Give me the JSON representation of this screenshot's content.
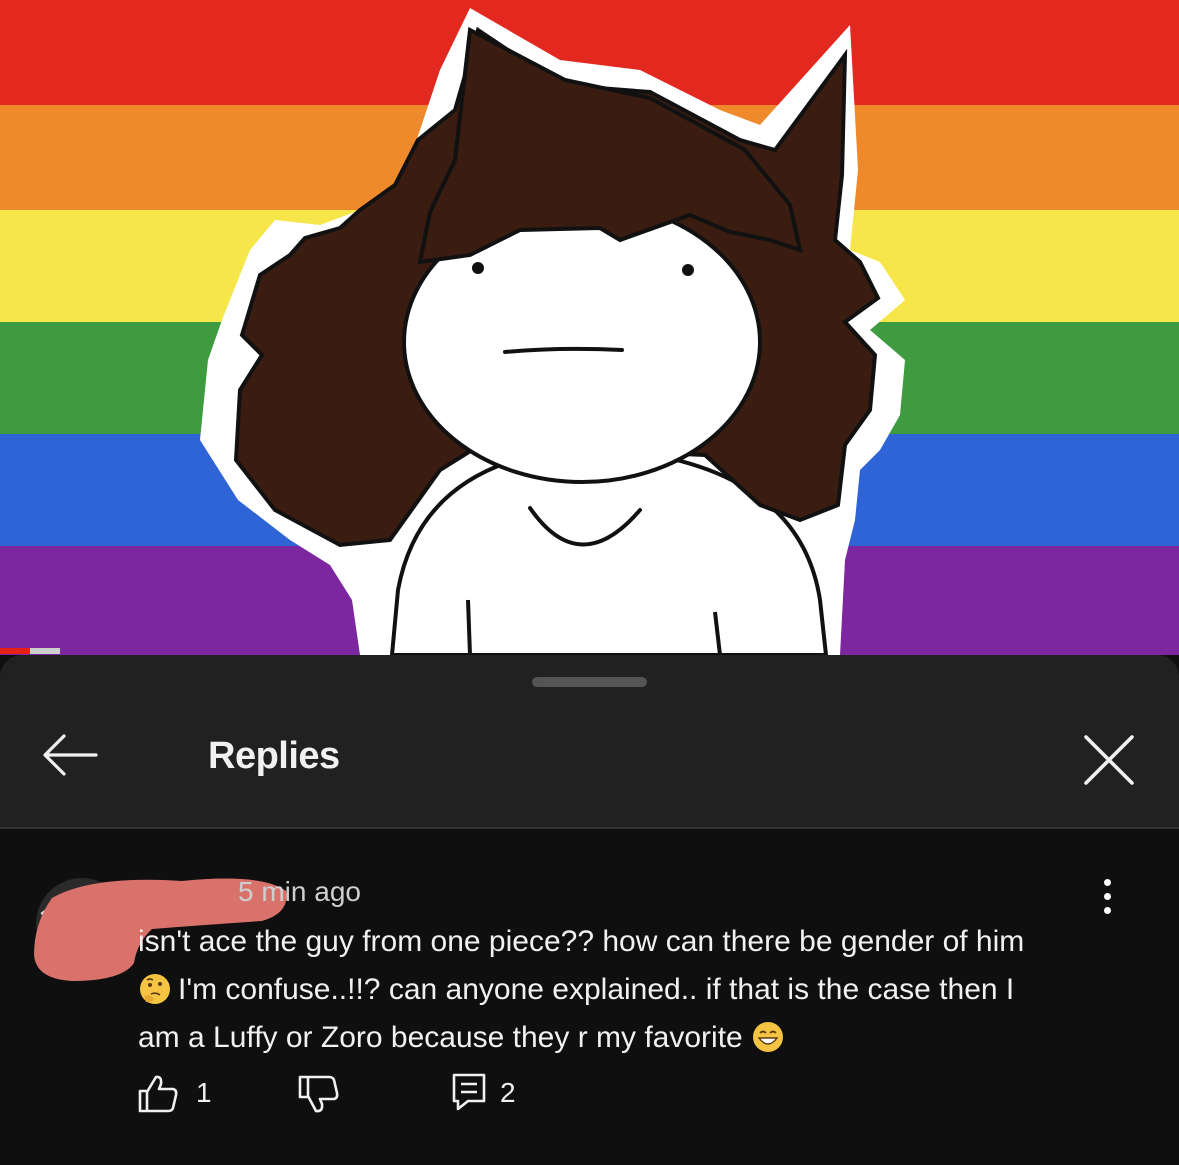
{
  "video": {
    "flag_colors": [
      "#e3291f",
      "#ef8a2c",
      "#f6e64a",
      "#3f9b3f",
      "#2f64d6",
      "#7c279f"
    ],
    "hair_color": "#3a1c10",
    "progress_fraction": 0.025
  },
  "sheet": {
    "title": "Replies",
    "back_icon": "arrow-left-icon",
    "close_icon": "close-icon"
  },
  "comment": {
    "time": "5 min ago",
    "lines": [
      "isn't ace the guy from one piece?? how can there be gender of him",
      "I'm confuse..!!? can anyone explained.. if that is the case then I",
      "am a Luffy or Zoro because they r my favorite"
    ],
    "emoji_thinking": "thinking-face-emoji",
    "emoji_grin": "grinning-face-emoji",
    "more_icon": "more-vertical-icon",
    "likes": "1",
    "replies": "2",
    "like_icon": "thumbs-up-icon",
    "dislike_icon": "thumbs-down-icon",
    "reply_icon": "comment-icon",
    "redaction_color": "#d9726a"
  }
}
